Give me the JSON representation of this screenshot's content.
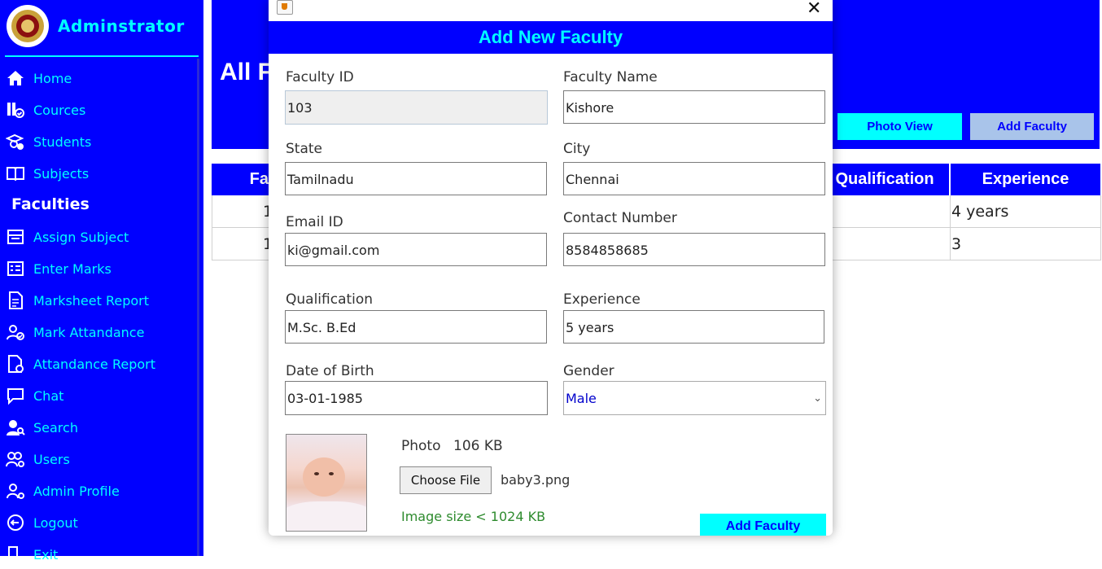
{
  "sidebar": {
    "title": "Adminstrator",
    "items": [
      {
        "label": "Home",
        "icon": "home-icon"
      },
      {
        "label": "Cources",
        "icon": "courses-icon"
      },
      {
        "label": "Students",
        "icon": "students-icon"
      },
      {
        "label": "Subjects",
        "icon": "book-icon"
      },
      {
        "label": "Faculties",
        "icon": "none",
        "active": true
      },
      {
        "label": "Assign Subject",
        "icon": "assign-icon"
      },
      {
        "label": "Enter Marks",
        "icon": "marks-icon"
      },
      {
        "label": "Marksheet Report",
        "icon": "report-icon"
      },
      {
        "label": "Mark Attandance",
        "icon": "attendance-icon"
      },
      {
        "label": "Attandance Report",
        "icon": "attendance-report-icon"
      },
      {
        "label": "Chat",
        "icon": "chat-icon"
      },
      {
        "label": "Search",
        "icon": "search-icon"
      },
      {
        "label": "Users",
        "icon": "users-icon"
      },
      {
        "label": "Admin Profile",
        "icon": "admin-profile-icon"
      },
      {
        "label": "Logout",
        "icon": "logout-icon"
      },
      {
        "label": "Exit",
        "icon": "exit-icon"
      }
    ]
  },
  "main": {
    "title": "All F",
    "photo_view_label": "Photo View",
    "add_faculty_label": "Add Faculty",
    "table": {
      "headers": [
        "Facu",
        "Qualification",
        "Experience"
      ],
      "rows": [
        {
          "id": "1",
          "qual": ":",
          "experience": "4 years"
        },
        {
          "id": "1",
          "qual": ":",
          "experience": "3"
        }
      ]
    }
  },
  "dialog": {
    "title": "Add New Faculty",
    "fields": {
      "faculty_id": {
        "label": "Faculty ID",
        "value": "103"
      },
      "faculty_name": {
        "label": "Faculty Name",
        "value": "Kishore"
      },
      "state": {
        "label": "State",
        "value": "Tamilnadu"
      },
      "city": {
        "label": "City",
        "value": "Chennai"
      },
      "email": {
        "label": "Email ID",
        "value": "ki@gmail.com"
      },
      "contact": {
        "label": "Contact Number",
        "value": "8584858685"
      },
      "qualification": {
        "label": "Qualification",
        "value": "M.Sc. B.Ed"
      },
      "experience": {
        "label": "Experience",
        "value": "5 years"
      },
      "dob": {
        "label": "Date of Birth",
        "value": "03-01-1985"
      },
      "gender": {
        "label": "Gender",
        "value": "Male"
      }
    },
    "photo": {
      "label": "Photo",
      "size": "106 KB",
      "choose_label": "Choose File",
      "file_name": "baby3.png",
      "size_hint": "Image size < 1024 KB",
      "hint_color": "#2e8b2e"
    },
    "submit_label": "Add Faculty"
  },
  "colors": {
    "primary": "#0000ff",
    "accent": "#00ffff"
  }
}
